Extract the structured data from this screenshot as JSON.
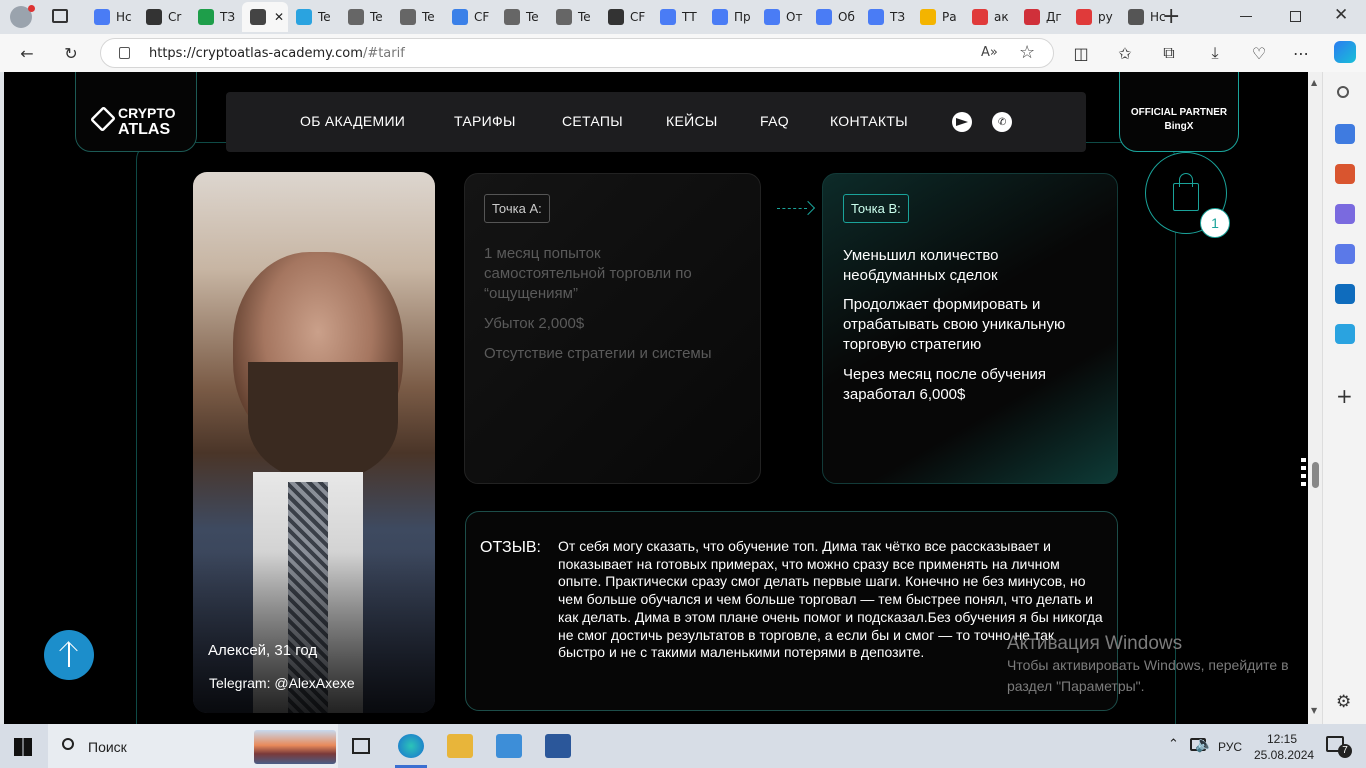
{
  "browser": {
    "tabs": [
      {
        "label": "Нс",
        "color": "#4a7cf5"
      },
      {
        "label": "Cr",
        "color": "#333333"
      },
      {
        "label": "ТЗ",
        "color": "#1e9e4a"
      },
      {
        "label": "",
        "color": "#444444",
        "active": true
      },
      {
        "label": "Te",
        "color": "#2aa3e0"
      },
      {
        "label": "Te",
        "color": "#666666"
      },
      {
        "label": "Te",
        "color": "#666666"
      },
      {
        "label": "CF",
        "color": "#3a80e8"
      },
      {
        "label": "Te",
        "color": "#666666"
      },
      {
        "label": "Te",
        "color": "#666666"
      },
      {
        "label": "CF",
        "color": "#333333"
      },
      {
        "label": "ТТ",
        "color": "#4a7cf5"
      },
      {
        "label": "Пр",
        "color": "#4a7cf5"
      },
      {
        "label": "От",
        "color": "#4a7cf5"
      },
      {
        "label": "Об",
        "color": "#4a7cf5"
      },
      {
        "label": "ТЗ",
        "color": "#4a7cf5"
      },
      {
        "label": "Ра",
        "color": "#f4b400"
      },
      {
        "label": "ак",
        "color": "#e03a3a"
      },
      {
        "label": "Дг",
        "color": "#d0303a"
      },
      {
        "label": "ру",
        "color": "#e03a3a"
      },
      {
        "label": "Нс",
        "color": "#555555"
      }
    ],
    "url_domain": "https://cryptoatlas-academy.com",
    "url_rest": "/#tarif",
    "reader_label": "A»"
  },
  "site": {
    "logo_line1": "CRYPTO",
    "logo_line2": "ATLAS",
    "nav": [
      "ОБ АКАДЕМИИ",
      "ТАРИФЫ",
      "СЕТАПЫ",
      "КЕЙСЫ",
      "FAQ",
      "КОНТАКТЫ"
    ],
    "partner_line1": "OFFICIAL PARTNER",
    "partner_line2": "BingX",
    "cart_count": "1",
    "person_name": "Алексей, 31 год",
    "person_telegram": "Telegram: @AlexAxexe",
    "point_a_label": "Точка А:",
    "point_a_items": [
      "1 месяц попыток самостоятельной торговли по “ощущениям”",
      "Убыток 2,000$",
      "Отсутствие стратегии и системы"
    ],
    "point_b_label": "Точка В:",
    "point_b_items": [
      "Уменьшил количество необдуманных сделок",
      "Продолжает формировать и отрабатывать свою уникальную торговую стратегию",
      "Через месяц после обучения заработал 6,000$"
    ],
    "review_label": "ОТЗЫВ:",
    "review_text": "От себя могу сказать, что обучение топ. Дима так чётко все рассказывает и показывает на готовых примерах, что можно сразу все применять на личном опыте. Практически сразу смог делать первые шаги. Конечно не без минусов, но чем больше обучался и чем больше торговал — тем быстрее понял, что делать и как делать. Дима в этом плане очень помог и подсказал.Без обучения я бы никогда не смог достичь результатов в торговле, а если бы и смог — то точно не так быстро и не с такими маленькими потерями в депозите.",
    "accent": "#1aa39a"
  },
  "activation": {
    "title": "Активация Windows",
    "line1": "Чтобы активировать Windows, перейдите в",
    "line2": "раздел \"Параметры\"."
  },
  "taskbar": {
    "search_placeholder": "Поиск",
    "lang": "РУС",
    "time": "12:15",
    "date": "25.08.2024",
    "notif_count": "7"
  }
}
